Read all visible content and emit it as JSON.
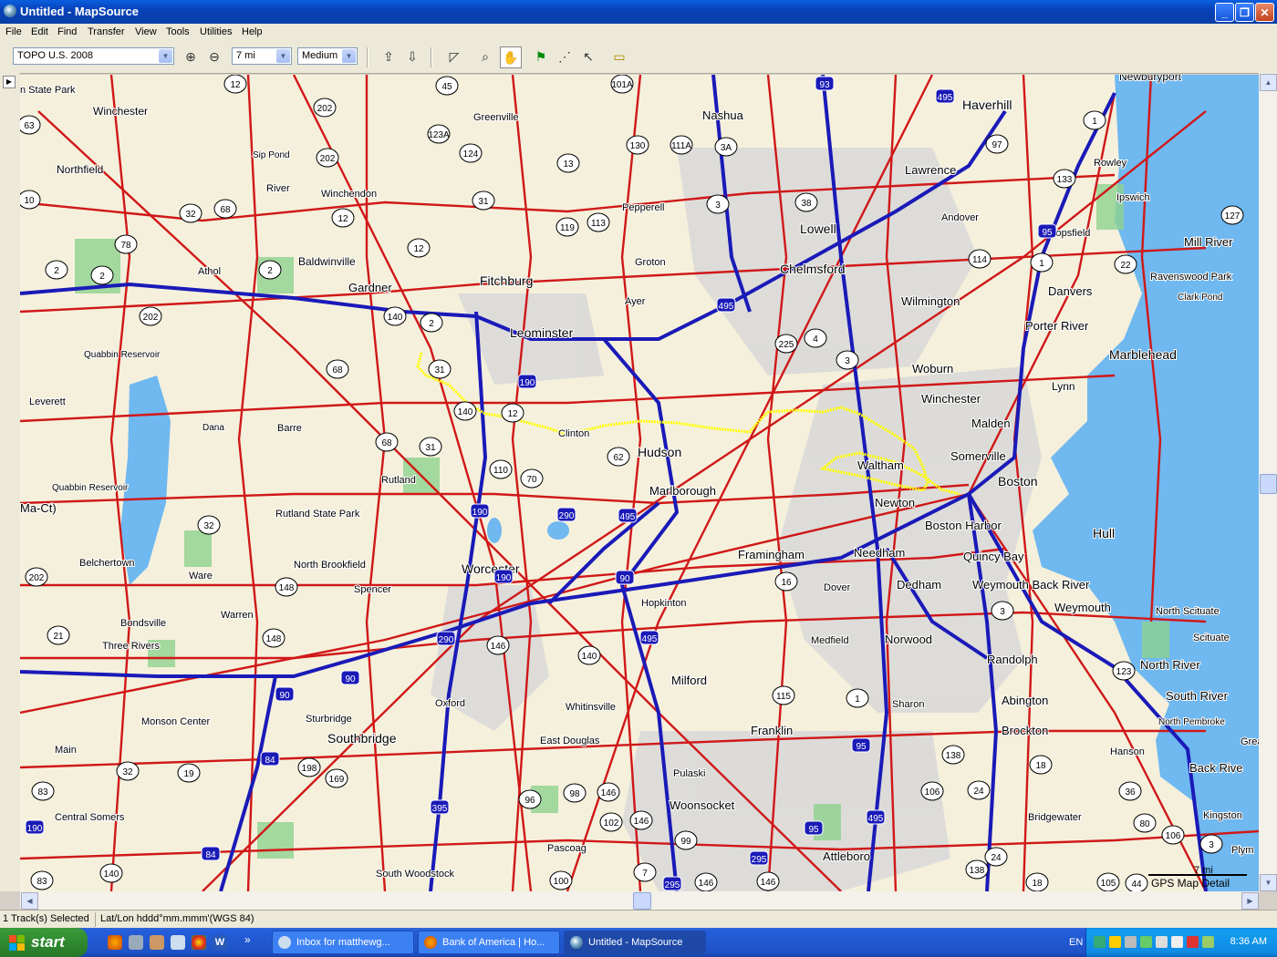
{
  "window": {
    "title": "Untitled - MapSource",
    "minimize_glyph": "_",
    "maximize_glyph": "❐",
    "close_glyph": "✕"
  },
  "menu": [
    "File",
    "Edit",
    "Find",
    "Transfer",
    "View",
    "Tools",
    "Utilities",
    "Help"
  ],
  "toolbar": {
    "map_product": "TOPO U.S. 2008",
    "zoom_scale": "7 mi",
    "detail_level": "Medium",
    "icons": [
      "zoom-in-icon",
      "zoom-out-icon",
      "receive-from-device-icon",
      "send-to-device-icon",
      "select-icon",
      "zoom-tool-icon",
      "hand-pan-icon",
      "waypoint-flag-icon",
      "route-icon",
      "pointer-icon",
      "measure-distance-icon"
    ]
  },
  "map": {
    "scale_label": "7 mi",
    "detail_label": "GPS Map Detail",
    "colors": {
      "land": "#f5f0dc",
      "urban": "#d8d8d8",
      "park": "#8fd28f",
      "water": "#6fb8f0",
      "ocean": "#6fb8f0",
      "major_road": "#d01818",
      "interstate": "#1a1ab8",
      "track": "#ffff00"
    },
    "places": [
      {
        "name": "Winchester"
      },
      {
        "name": "Northfield"
      },
      {
        "name": "Sip Pond"
      },
      {
        "name": "River"
      },
      {
        "name": "Winchendon"
      },
      {
        "name": "Greenville"
      },
      {
        "name": "Nashua"
      },
      {
        "name": "Haverhill"
      },
      {
        "name": "Newburyport"
      },
      {
        "name": "Lawrence"
      },
      {
        "name": "Rowley"
      },
      {
        "name": "Ipswich"
      },
      {
        "name": "Pepperell"
      },
      {
        "name": "Lowell"
      },
      {
        "name": "Andover"
      },
      {
        "name": "Topsfield"
      },
      {
        "name": "Mill River"
      },
      {
        "name": "Baldwinville"
      },
      {
        "name": "Athol"
      },
      {
        "name": "Gardner"
      },
      {
        "name": "Fitchburg"
      },
      {
        "name": "Groton"
      },
      {
        "name": "Chelmsford"
      },
      {
        "name": "Danvers"
      },
      {
        "name": "Ravenswood Park"
      },
      {
        "name": "Clark Pond"
      },
      {
        "name": "Wilmington"
      },
      {
        "name": "Ayer"
      },
      {
        "name": "Leominster"
      },
      {
        "name": "Porter River"
      },
      {
        "name": "Marblehead"
      },
      {
        "name": "Quabbin Reservoir"
      },
      {
        "name": "Woburn"
      },
      {
        "name": "Lynn"
      },
      {
        "name": "Winchester"
      },
      {
        "name": "Leverett"
      },
      {
        "name": "Dana"
      },
      {
        "name": "Barre"
      },
      {
        "name": "Clinton"
      },
      {
        "name": "Malden"
      },
      {
        "name": "Hudson"
      },
      {
        "name": "Somerville"
      },
      {
        "name": "Waltham"
      },
      {
        "name": "Boston"
      },
      {
        "name": "Rutland"
      },
      {
        "name": "Marlborough"
      },
      {
        "name": "Newton"
      },
      {
        "name": "Ma-Ct)"
      },
      {
        "name": "Rutland State Park"
      },
      {
        "name": "Boston Harbor"
      },
      {
        "name": "Hull"
      },
      {
        "name": "Framingham"
      },
      {
        "name": "Needham"
      },
      {
        "name": "Quincy Bay"
      },
      {
        "name": "Belchertown"
      },
      {
        "name": "North Brookfield"
      },
      {
        "name": "Worcester"
      },
      {
        "name": "Dedham"
      },
      {
        "name": "Weymouth Back River"
      },
      {
        "name": "Ware"
      },
      {
        "name": "Spencer"
      },
      {
        "name": "Dover"
      },
      {
        "name": "Weymouth"
      },
      {
        "name": "North Scituate"
      },
      {
        "name": "Hopkinton"
      },
      {
        "name": "Bondsville"
      },
      {
        "name": "Warren"
      },
      {
        "name": "Scituate"
      },
      {
        "name": "Three Rivers"
      },
      {
        "name": "Medfield"
      },
      {
        "name": "Norwood"
      },
      {
        "name": "Randolph"
      },
      {
        "name": "North River"
      },
      {
        "name": "Milford"
      },
      {
        "name": "Abington"
      },
      {
        "name": "South River"
      },
      {
        "name": "Oxford"
      },
      {
        "name": "Whitinsville"
      },
      {
        "name": "Sharon"
      },
      {
        "name": "Monson Center"
      },
      {
        "name": "Sturbridge"
      },
      {
        "name": "Franklin"
      },
      {
        "name": "North Pembroke"
      },
      {
        "name": "Southbridge"
      },
      {
        "name": "Brockton"
      },
      {
        "name": "East Douglas"
      },
      {
        "name": "Hanson"
      },
      {
        "name": "Main"
      },
      {
        "name": "Pulaski"
      },
      {
        "name": "Back Rive"
      },
      {
        "name": "Woonsocket"
      },
      {
        "name": "Kingston"
      },
      {
        "name": "Central Somers"
      },
      {
        "name": "Bridgewater"
      },
      {
        "name": "Pascoag"
      },
      {
        "name": "Attleboro"
      },
      {
        "name": "South Woodstock"
      },
      {
        "name": "Plym"
      },
      {
        "name": "n State Park"
      },
      {
        "name": "Quabbin Reservoir"
      },
      {
        "name": "Grea"
      }
    ],
    "shields": [
      "12",
      "45",
      "101A",
      "93",
      "495",
      "63",
      "202",
      "123A",
      "130",
      "111A",
      "3A",
      "97",
      "1",
      "124",
      "202",
      "13",
      "133",
      "10",
      "31",
      "32",
      "68",
      "12",
      "119",
      "113",
      "3",
      "38",
      "127",
      "78",
      "12",
      "95",
      "2",
      "2",
      "114",
      "1",
      "22",
      "202",
      "2",
      "140",
      "2",
      "495",
      "225",
      "4",
      "3",
      "68",
      "31",
      "190",
      "140",
      "12",
      "68",
      "31",
      "110",
      "70",
      "62",
      "90",
      "190",
      "290",
      "495",
      "32",
      "202",
      "148",
      "16",
      "148",
      "3",
      "21",
      "190",
      "290",
      "146",
      "140",
      "495",
      "115",
      "1",
      "90",
      "90",
      "123",
      "84",
      "198",
      "95",
      "138",
      "32",
      "19",
      "169",
      "18",
      "83",
      "96",
      "98",
      "146",
      "106",
      "24",
      "36",
      "190",
      "102",
      "146",
      "99",
      "95",
      "495",
      "106",
      "80",
      "3",
      "84",
      "395",
      "295",
      "138",
      "24",
      "140",
      "83",
      "100",
      "7",
      "295",
      "146",
      "18",
      "105",
      "44",
      "146"
    ]
  },
  "status": {
    "selection": "1 Track(s) Selected",
    "coord_format": "Lat/Lon hddd°mm.mmm'(WGS 84)"
  },
  "taskbar": {
    "start_label": "start",
    "tasks": [
      {
        "label": "Inbox for matthewg..."
      },
      {
        "label": "Bank of America | Ho..."
      },
      {
        "label": "Untitled - MapSource"
      }
    ],
    "language": "EN",
    "clock": "8:36 AM",
    "overflow_glyph": "»"
  }
}
